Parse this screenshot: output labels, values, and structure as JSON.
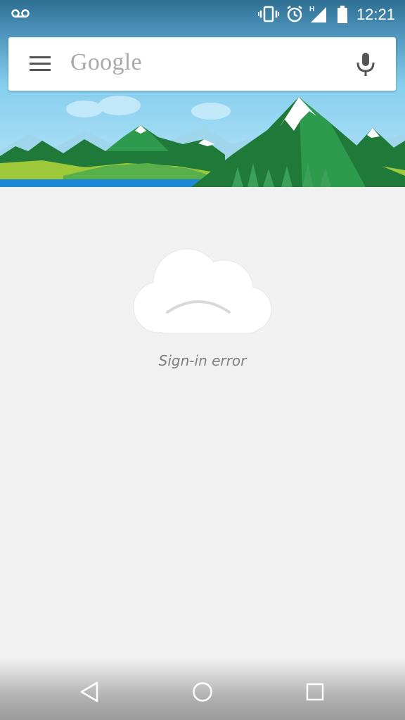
{
  "status_bar": {
    "time": "12:21",
    "network_type": "H",
    "icons": [
      "voicemail-icon",
      "vibrate-icon",
      "alarm-icon",
      "signal-icon",
      "battery-icon"
    ]
  },
  "search": {
    "logo_text": "Google",
    "icons": [
      "menu-icon",
      "mic-icon"
    ]
  },
  "main": {
    "message": "Sign-in error",
    "illustration": "cloud-sad-icon"
  },
  "nav_bar": {
    "buttons": [
      "back-icon",
      "home-icon",
      "recents-icon"
    ]
  },
  "colors": {
    "background": "#f1f1f1",
    "sky": "#8fd3ef",
    "mountain_dark": "#1f7a3a",
    "mountain_light": "#3aa05a",
    "meadow": "#9cc83a",
    "water": "#1e88d8",
    "text_muted": "#808080"
  }
}
